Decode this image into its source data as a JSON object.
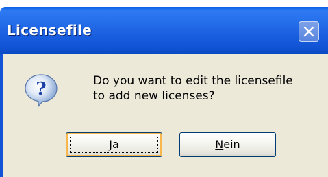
{
  "window": {
    "title": "Licensefile",
    "close_icon": "close-icon",
    "title_color": "#1a5fdf",
    "body_color": "#ece9d8"
  },
  "dialog": {
    "icon": "question-icon",
    "message_line1": "Do you want to edit the licensefile",
    "message_line2": "to add new licenses?"
  },
  "buttons": {
    "yes": {
      "mnemonic": "J",
      "rest": "a",
      "label": "Ja"
    },
    "no": {
      "mnemonic": "N",
      "rest": "ein",
      "label": "Nein"
    }
  }
}
